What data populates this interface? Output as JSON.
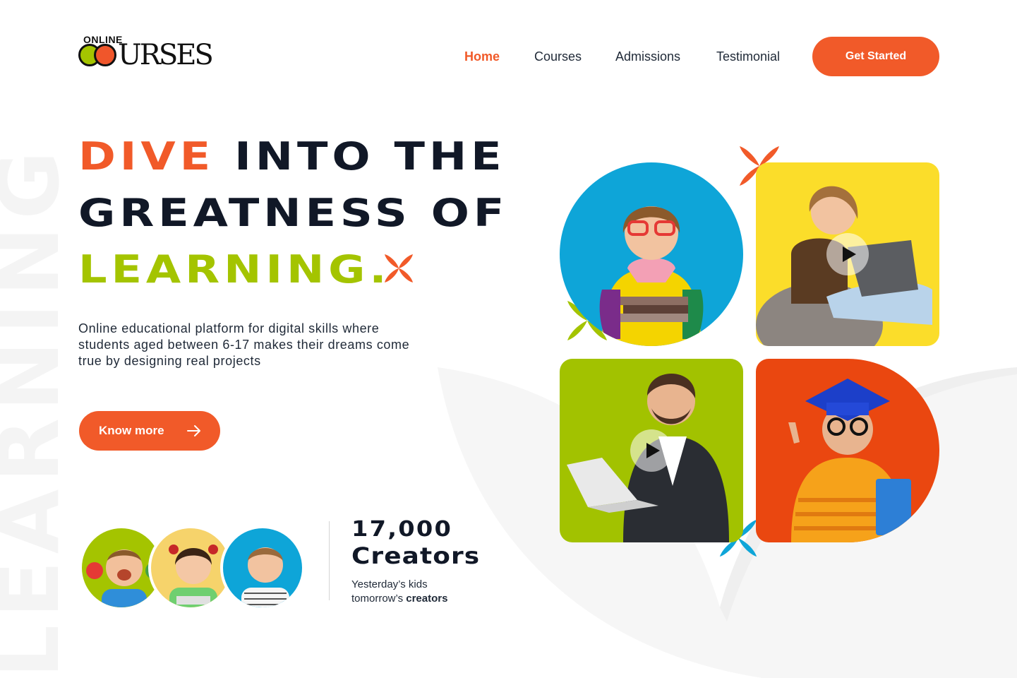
{
  "brand": {
    "logo_small": "ONLINE",
    "logo_main": "COURSES"
  },
  "nav": [
    {
      "label": "Home",
      "active": true
    },
    {
      "label": "Courses",
      "active": false
    },
    {
      "label": "Admissions",
      "active": false
    },
    {
      "label": "Testimonial",
      "active": false
    }
  ],
  "header": {
    "cta_label": "Get Started"
  },
  "hero": {
    "line1_accent": "DIVE",
    "line1_rest": "INTO THE",
    "line2": "GREATNESS OF",
    "line3": "LEARNING.",
    "description_lines": [
      "Online educational platform for digital skills where",
      "students aged between 6-17 makes their dreams come",
      "true by designing real projects"
    ],
    "button_label": "Know more",
    "background_word": "LEARNING"
  },
  "stats": {
    "number": "17,000",
    "label": "Creators",
    "sub_line1": "Yesterday’s kids",
    "sub_line2_prefix": "tomorrow’s",
    "sub_line2_bold": "creators"
  },
  "colors": {
    "accent": "#f15a29",
    "green": "#a4c400",
    "blue": "#0ea5d8",
    "yellow": "#fbdd2a",
    "dark": "#111827"
  }
}
